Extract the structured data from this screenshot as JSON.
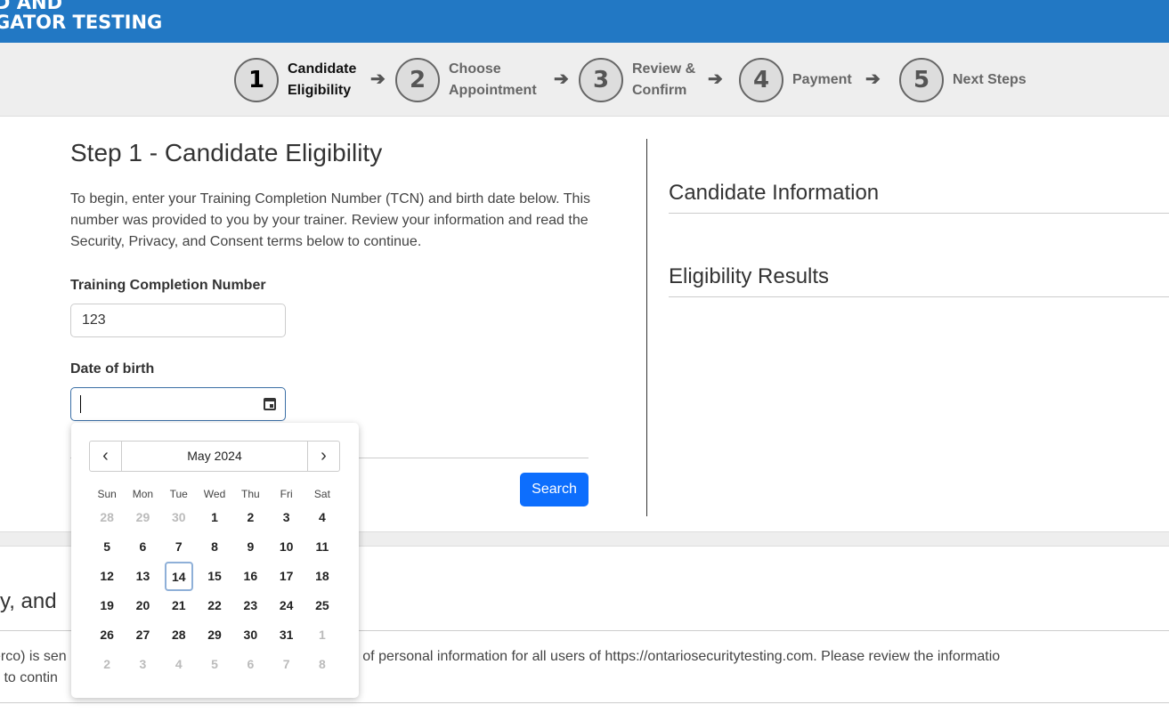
{
  "header": {
    "title_line1": "D AND",
    "title_line2": "GATOR TESTING"
  },
  "steps": [
    {
      "num": "1",
      "l1": "Candidate",
      "l2": "Eligibility"
    },
    {
      "num": "2",
      "l1": "Choose",
      "l2": "Appointment"
    },
    {
      "num": "3",
      "l1": "Review &",
      "l2": "Confirm"
    },
    {
      "num": "4",
      "l1": "Payment",
      "l2": ""
    },
    {
      "num": "5",
      "l1": "Next Steps",
      "l2": ""
    }
  ],
  "main": {
    "title": "Step 1 - Candidate Eligibility",
    "intro": "To begin, enter your Training Completion Number (TCN) and birth date below. This number was provided to you by your trainer. Review your information and read the Security, Privacy, and Consent terms below to continue.",
    "tcn_label": "Training Completion Number",
    "tcn_value": "123",
    "dob_label": "Date of birth",
    "dob_value": "",
    "search_label": "Search"
  },
  "right": {
    "candidate_info": "Candidate Information",
    "eligibility": "Eligibility Results"
  },
  "section": {
    "title": "cy, and",
    "line1": "erco) is sen                                            ent, and protection of personal information for all users of https://ontariosecuritytesting.com. Please review the informatio",
    "line2": "x to contin"
  },
  "datepicker": {
    "month": "May 2024",
    "prev_icon": "chevron-left-icon",
    "next_icon": "chevron-right-icon",
    "weekdays": [
      "Sun",
      "Mon",
      "Tue",
      "Wed",
      "Thu",
      "Fri",
      "Sat"
    ],
    "days": [
      "28",
      "29",
      "30",
      "1",
      "2",
      "3",
      "4",
      "5",
      "6",
      "7",
      "8",
      "9",
      "10",
      "11",
      "12",
      "13",
      "14",
      "15",
      "16",
      "17",
      "18",
      "19",
      "20",
      "21",
      "22",
      "23",
      "24",
      "25",
      "26",
      "27",
      "28",
      "29",
      "30",
      "31",
      "1",
      "2",
      "3",
      "4",
      "5",
      "6",
      "7",
      "8"
    ],
    "today": "14"
  },
  "colors": {
    "header": "#2278c4",
    "button": "#0d6efd"
  }
}
